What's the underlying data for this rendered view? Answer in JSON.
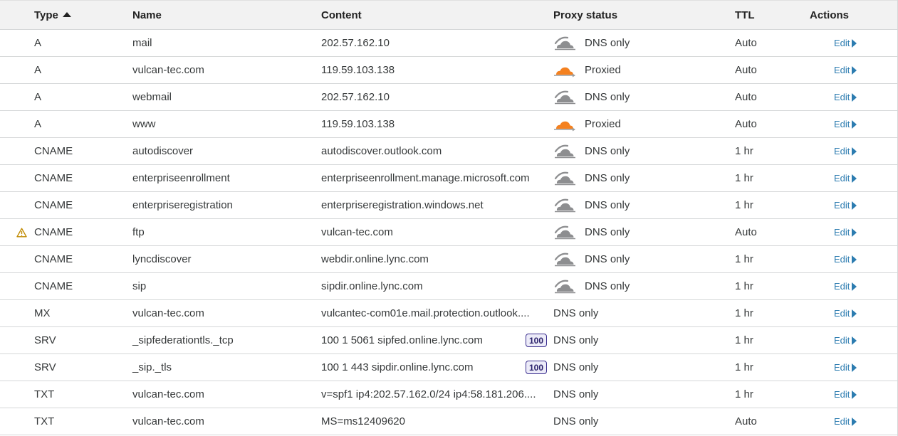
{
  "headers": {
    "type": "Type",
    "name": "Name",
    "content": "Content",
    "proxy_status": "Proxy status",
    "ttl": "TTL",
    "actions": "Actions"
  },
  "edit_label": "Edit",
  "colors": {
    "proxied_cloud": "#f48120",
    "dns_only_cloud": "#8d8e90",
    "link": "#2c7cb0",
    "warning": "#c08a00"
  },
  "records": [
    {
      "type": "A",
      "name": "mail",
      "content": "202.57.162.10",
      "proxy": "DNS only",
      "cloud": "dns-only-cloud-icon",
      "ttl": "Auto",
      "warn": false,
      "badge": ""
    },
    {
      "type": "A",
      "name": "vulcan-tec.com",
      "content": "119.59.103.138",
      "proxy": "Proxied",
      "cloud": "proxied-cloud-icon",
      "ttl": "Auto",
      "warn": false,
      "badge": ""
    },
    {
      "type": "A",
      "name": "webmail",
      "content": "202.57.162.10",
      "proxy": "DNS only",
      "cloud": "dns-only-cloud-icon",
      "ttl": "Auto",
      "warn": false,
      "badge": ""
    },
    {
      "type": "A",
      "name": "www",
      "content": "119.59.103.138",
      "proxy": "Proxied",
      "cloud": "proxied-cloud-icon",
      "ttl": "Auto",
      "warn": false,
      "badge": ""
    },
    {
      "type": "CNAME",
      "name": "autodiscover",
      "content": "autodiscover.outlook.com",
      "proxy": "DNS only",
      "cloud": "dns-only-cloud-icon",
      "ttl": "1 hr",
      "warn": false,
      "badge": ""
    },
    {
      "type": "CNAME",
      "name": "enterpriseenrollment",
      "content": "enterpriseenrollment.manage.microsoft.com",
      "proxy": "DNS only",
      "cloud": "dns-only-cloud-icon",
      "ttl": "1 hr",
      "warn": false,
      "badge": ""
    },
    {
      "type": "CNAME",
      "name": "enterpriseregistration",
      "content": "enterpriseregistration.windows.net",
      "proxy": "DNS only",
      "cloud": "dns-only-cloud-icon",
      "ttl": "1 hr",
      "warn": false,
      "badge": ""
    },
    {
      "type": "CNAME",
      "name": "ftp",
      "content": "vulcan-tec.com",
      "proxy": "DNS only",
      "cloud": "dns-only-cloud-icon",
      "ttl": "Auto",
      "warn": true,
      "badge": ""
    },
    {
      "type": "CNAME",
      "name": "lyncdiscover",
      "content": "webdir.online.lync.com",
      "proxy": "DNS only",
      "cloud": "dns-only-cloud-icon",
      "ttl": "1 hr",
      "warn": false,
      "badge": ""
    },
    {
      "type": "CNAME",
      "name": "sip",
      "content": "sipdir.online.lync.com",
      "proxy": "DNS only",
      "cloud": "dns-only-cloud-icon",
      "ttl": "1 hr",
      "warn": false,
      "badge": ""
    },
    {
      "type": "MX",
      "name": "vulcan-tec.com",
      "content": "vulcantec-com01e.mail.protection.outlook....",
      "proxy": "DNS only",
      "cloud": "",
      "ttl": "1 hr",
      "warn": false,
      "badge": ""
    },
    {
      "type": "SRV",
      "name": "_sipfederationtls._tcp",
      "content": "100 1 5061 sipfed.online.lync.com",
      "proxy": "DNS only",
      "cloud": "",
      "ttl": "1 hr",
      "warn": false,
      "badge": "100"
    },
    {
      "type": "SRV",
      "name": "_sip._tls",
      "content": "100 1 443 sipdir.online.lync.com",
      "proxy": "DNS only",
      "cloud": "",
      "ttl": "1 hr",
      "warn": false,
      "badge": "100"
    },
    {
      "type": "TXT",
      "name": "vulcan-tec.com",
      "content": "v=spf1 ip4:202.57.162.0/24 ip4:58.181.206....",
      "proxy": "DNS only",
      "cloud": "",
      "ttl": "1 hr",
      "warn": false,
      "badge": ""
    },
    {
      "type": "TXT",
      "name": "vulcan-tec.com",
      "content": "MS=ms12409620",
      "proxy": "DNS only",
      "cloud": "",
      "ttl": "Auto",
      "warn": false,
      "badge": ""
    }
  ]
}
